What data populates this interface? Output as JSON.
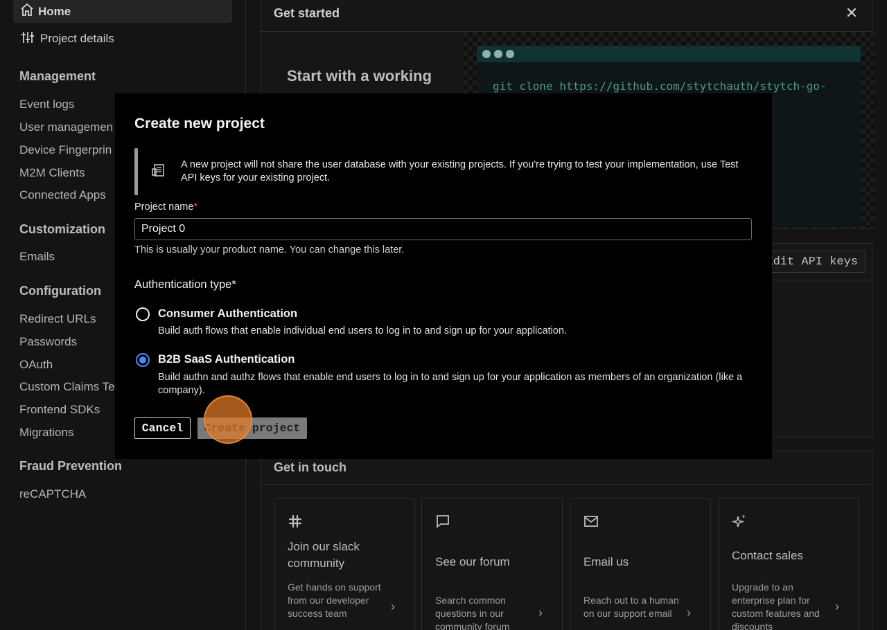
{
  "sidebar": {
    "home": "Home",
    "project_details": "Project details",
    "sections": [
      {
        "title": "Management",
        "items": [
          "Event logs",
          "User managemen",
          "Device Fingerprin",
          "M2M Clients",
          "Connected Apps"
        ]
      },
      {
        "title": "Customization",
        "items": [
          "Emails"
        ]
      },
      {
        "title": "Configuration",
        "items": [
          "Redirect URLs",
          "Passwords",
          "OAuth",
          "Custom Claims Te",
          "Frontend SDKs",
          "Migrations"
        ]
      },
      {
        "title": "Fraud Prevention",
        "items": [
          "reCAPTCHA"
        ]
      }
    ]
  },
  "get_started": {
    "title": "Get started",
    "close": "✕",
    "start_text": "Start with a working",
    "code": "git clone https://github.com/stytchauth/stytch-go-",
    "edit_api_keys": "Edit API keys"
  },
  "get_in_touch": {
    "title": "Get in touch",
    "cards": [
      {
        "icon": "slack-icon",
        "title": "Join our slack community",
        "desc": "Get hands on support from our developer success team"
      },
      {
        "icon": "forum-icon",
        "title": "See our forum",
        "desc": "Search common questions in our community forum"
      },
      {
        "icon": "email-icon",
        "title": "Email us",
        "desc": "Reach out to a human on our support email"
      },
      {
        "icon": "sparkle-icon",
        "title": "Contact sales",
        "desc": "Upgrade to an enterprise plan for custom features and discounts"
      }
    ]
  },
  "modal": {
    "title": "Create new project",
    "callout": "A new project will not share the user database with your existing projects. If you're trying to test your implementation, use Test API keys for your existing project.",
    "project_name_label": "Project name",
    "required_mark": "*",
    "project_name_value": "Project 0",
    "project_name_help": "This is usually your product name. You can change this later.",
    "auth_type_label": "Authentication type*",
    "options": [
      {
        "title": "Consumer Authentication",
        "desc": "Build auth flows that enable individual end users to log in to and sign up for your application.",
        "selected": false
      },
      {
        "title": "B2B SaaS Authentication",
        "desc": "Build authn and authz flows that enable end users to log in to and sign up for your application as members of an organization (like a company).",
        "selected": true
      }
    ],
    "cancel_label": "Cancel",
    "create_label": "Create project"
  },
  "colors": {
    "accent_radio": "#4a8cf7",
    "required": "#e0564f",
    "cursor": "#e27a2a"
  }
}
